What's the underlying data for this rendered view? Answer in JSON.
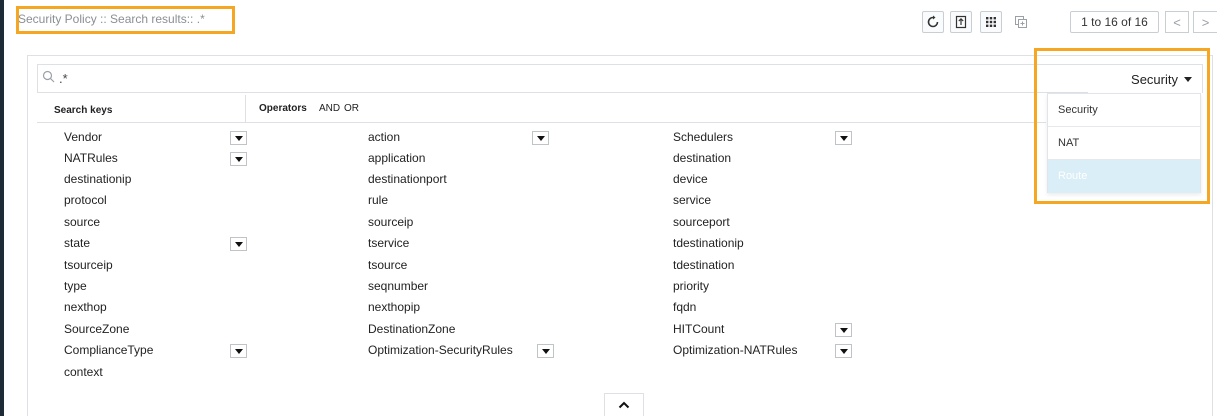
{
  "header": {
    "title": "Security Policy :: Search results:: .*"
  },
  "toolbar": {
    "pager_text": "1 to 16 of 16",
    "icons": [
      "refresh-icon",
      "export-icon",
      "grid-icon",
      "copy-icon"
    ],
    "prev_glyph": "<",
    "next_glyph": ">"
  },
  "search": {
    "value": ".*"
  },
  "policy_select": {
    "selected": "Security",
    "options": [
      "Security",
      "NAT",
      "Route"
    ],
    "hovered": "Route"
  },
  "table": {
    "keys_header": "Search keys",
    "operators_label": "Operators",
    "operators": [
      "AND",
      "OR"
    ]
  },
  "keys": {
    "col1": [
      "Vendor",
      "NATRules",
      "destinationip",
      "protocol",
      "source",
      "state",
      "tsourceip",
      "type",
      "nexthop",
      "SourceZone",
      "ComplianceType",
      "context"
    ],
    "col2": [
      "action",
      "application",
      "destinationport",
      "rule",
      "sourceip",
      "tservice",
      "tsource",
      "seqnumber",
      "nexthopip",
      "DestinationZone",
      "Optimization-SecurityRules"
    ],
    "col3": [
      "Schedulers",
      "destination",
      "device",
      "service",
      "sourceport",
      "tdestinationip",
      "tdestination",
      "priority",
      "fqdn",
      "HITCount",
      "Optimization-NATRules"
    ]
  },
  "colors": {
    "highlight": "#f5a623",
    "menu_selected_bg": "#d9eef6"
  }
}
